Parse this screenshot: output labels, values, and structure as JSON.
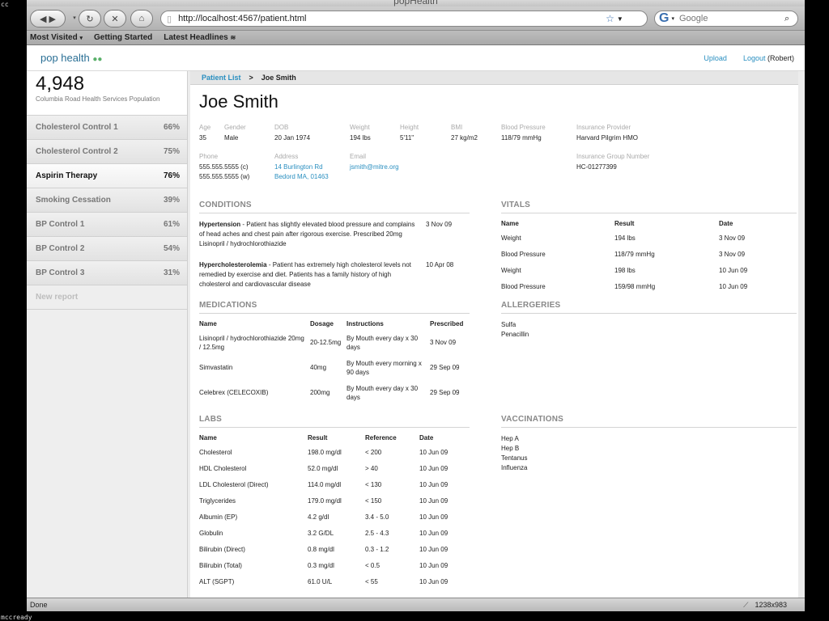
{
  "corner_tags": {
    "top_left": "cc",
    "bottom_left": "mccready"
  },
  "browser": {
    "window_title": "popHealth",
    "url": "http://localhost:4567/patient.html",
    "search_placeholder": "Google",
    "bookmarks": [
      "Most Visited",
      "Getting Started",
      "Latest Headlines"
    ],
    "status": "Done",
    "size_readout": "1238x983"
  },
  "app": {
    "logo_text": "pop health",
    "upload": "Upload",
    "logout": "Logout",
    "user": "(Robert)"
  },
  "sidebar": {
    "population_count": "4,948",
    "population_label": "Columbia Road Health Services Population",
    "reports": [
      {
        "name": "Cholesterol Control 1",
        "pct": "66%"
      },
      {
        "name": "Cholesterol Control 2",
        "pct": "75%"
      },
      {
        "name": "Aspirin Therapy",
        "pct": "76%"
      },
      {
        "name": "Smoking Cessation",
        "pct": "39%"
      },
      {
        "name": "BP Control 1",
        "pct": "61%"
      },
      {
        "name": "BP Control 2",
        "pct": "54%"
      },
      {
        "name": "BP Control 3",
        "pct": "31%"
      }
    ],
    "new_report": "New report"
  },
  "breadcrumb": {
    "list": "Patient List",
    "sep": ">",
    "current": "Joe Smith"
  },
  "patient": {
    "name": "Joe Smith",
    "age_label": "Age",
    "age": "35",
    "gender_label": "Gender",
    "gender": "Male",
    "dob_label": "DOB",
    "dob": "20 Jan 1974",
    "weight_label": "Weight",
    "weight": "194 lbs",
    "height_label": "Height",
    "height": "5'11\"",
    "bmi_label": "BMI",
    "bmi": "27 kg/m2",
    "bp_label": "Blood Pressure",
    "bp": "118/79 mmHg",
    "insurance_label": "Insurance Provider",
    "insurance": "Harvard Pilgrim HMO",
    "phone_label": "Phone",
    "phone_cell": "555.555.5555 (c)",
    "phone_work": "555.555.5555 (w)",
    "address_label": "Address",
    "address_1": "14 Burlington Rd",
    "address_2": "Bedord MA, 01463",
    "email_label": "Email",
    "email": "jsmith@mitre.org",
    "group_label": "Insurance Group Number",
    "group": "HC-01277399"
  },
  "conditions": {
    "title": "CONDITIONS",
    "items": [
      {
        "name": "Hypertension",
        "text": " - Patient has slightly elevated blood pressure and complains of head aches and chest pain after rigorous exercise. Prescribed 20mg Lisinopril / hydrochlorothiazide",
        "date": "3 Nov 09"
      },
      {
        "name": "Hypercholesterolemia",
        "text": " - Patient has extremely high cholesterol levels not remedied by exercise and diet. Patients has a family history of high cholesterol and cardiovascular disease",
        "date": "10 Apr 08"
      }
    ]
  },
  "medications": {
    "title": "MEDICATIONS",
    "headers": [
      "Name",
      "Dosage",
      "Instructions",
      "Prescribed"
    ],
    "rows": [
      [
        "Lisinopril / hydrochlorothiazide 20mg / 12.5mg",
        "20-12.5mg",
        "By Mouth every day x 30 days",
        "3 Nov 09"
      ],
      [
        "Simvastatin",
        "40mg",
        "By Mouth every morning x 90 days",
        "29 Sep 09"
      ],
      [
        "Celebrex (CELECOXIB)",
        "200mg",
        "By Mouth every day x 30 days",
        "29 Sep 09"
      ]
    ]
  },
  "labs": {
    "title": "LABS",
    "headers": [
      "Name",
      "Result",
      "Reference",
      "Date"
    ],
    "rows": [
      [
        "Cholesterol",
        "198.0 mg/dl",
        "< 200",
        "10 Jun 09"
      ],
      [
        "HDL Cholesterol",
        "52.0 mg/dl",
        "> 40",
        "10 Jun 09"
      ],
      [
        "LDL Cholesterol (Direct)",
        "114.0 mg/dl",
        "< 130",
        "10 Jun 09"
      ],
      [
        "Triglycerides",
        "179.0 mg/dl",
        "< 150",
        "10 Jun 09"
      ],
      [
        "Albumin (EP)",
        "4.2 g/dl",
        "3.4 - 5.0",
        "10 Jun 09"
      ],
      [
        "Globulin",
        "3.2 G/DL",
        "2.5 - 4.3",
        "10 Jun 09"
      ],
      [
        "Bilirubin (Direct)",
        "0.8 mg/dl",
        "0.3 - 1.2",
        "10 Jun 09"
      ],
      [
        "Bilirubin (Total)",
        "0.3 mg/dl",
        "< 0.5",
        "10 Jun 09"
      ],
      [
        "ALT (SGPT)",
        "61.0 U/L",
        "< 55",
        "10 Jun 09"
      ]
    ]
  },
  "vitals": {
    "title": "VITALS",
    "headers": [
      "Name",
      "Result",
      "Date"
    ],
    "rows": [
      [
        "Weight",
        "194 lbs",
        "3 Nov 09"
      ],
      [
        "Blood Pressure",
        "118/79 mmHg",
        "3 Nov 09"
      ],
      [
        "Weight",
        "198 lbs",
        "10 Jun 09"
      ],
      [
        "Blood Pressure",
        "159/98 mmHg",
        "10 Jun 09"
      ]
    ]
  },
  "allergies": {
    "title": "ALLERGERIES",
    "items": [
      "Sulfa",
      "Penacillin"
    ]
  },
  "vaccinations": {
    "title": "VACCINATIONS",
    "items": [
      "Hep A",
      "Hep B",
      "Tentanus",
      "Influenza"
    ]
  }
}
